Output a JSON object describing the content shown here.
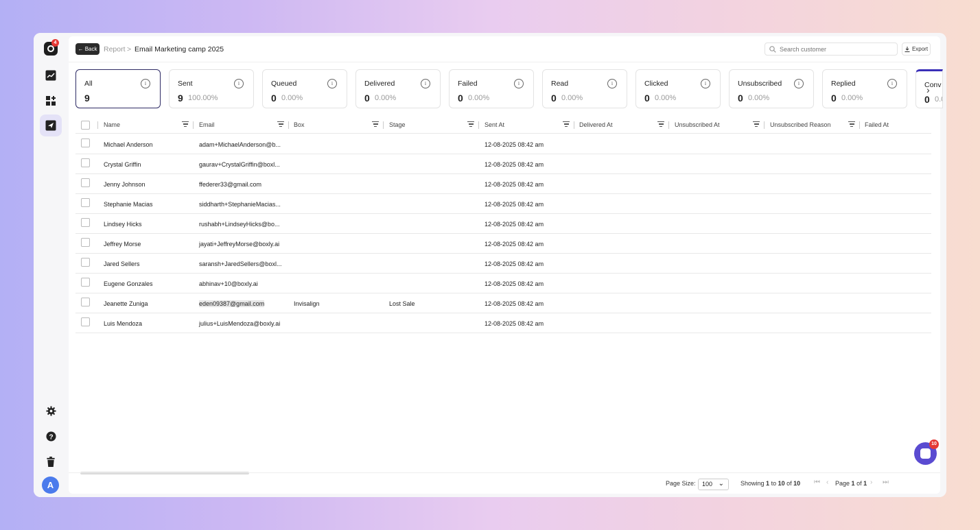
{
  "app": {
    "logo_badge": "4",
    "avatar_initial": "A",
    "chat_badge": "10"
  },
  "sidebar": {
    "items": [
      {
        "icon": "analytics-icon"
      },
      {
        "icon": "widgets-icon"
      },
      {
        "icon": "send-icon",
        "active": true
      }
    ],
    "bottom": [
      {
        "icon": "gear-icon"
      },
      {
        "icon": "help-icon"
      },
      {
        "icon": "trash-icon"
      }
    ]
  },
  "header": {
    "back_label": "← Back",
    "breadcrumb": {
      "parent": "Report",
      "separator": ">",
      "current": "Email Marketing camp 2025"
    },
    "search_placeholder": "Search customer",
    "export_label": "Export"
  },
  "cards": [
    {
      "label": "All",
      "count": "9",
      "pct": "",
      "active": true
    },
    {
      "label": "Sent",
      "count": "9",
      "pct": "100.00%"
    },
    {
      "label": "Queued",
      "count": "0",
      "pct": "0.00%"
    },
    {
      "label": "Delivered",
      "count": "0",
      "pct": "0.00%"
    },
    {
      "label": "Failed",
      "count": "0",
      "pct": "0.00%"
    },
    {
      "label": "Read",
      "count": "0",
      "pct": "0.00%"
    },
    {
      "label": "Clicked",
      "count": "0",
      "pct": "0.00%"
    },
    {
      "label": "Unsubscribed",
      "count": "0",
      "pct": "0.00%"
    },
    {
      "label": "Replied",
      "count": "0",
      "pct": "0.00%"
    },
    {
      "label": "Conv",
      "count": "0",
      "pct": "0.0"
    }
  ],
  "table": {
    "columns": [
      "Name",
      "Email",
      "Box",
      "Stage",
      "Sent At",
      "Delivered At",
      "Unsubscribed At",
      "Unsubscribed Reason",
      "Failed At"
    ],
    "rows": [
      {
        "name": "Michael Anderson",
        "email": "adam+MichaelAnderson@b...",
        "box": "",
        "stage": "",
        "sent_at": "12-08-2025 08:42 am"
      },
      {
        "name": "Crystal Griffin",
        "email": "gaurav+CrystalGriffin@boxl...",
        "box": "",
        "stage": "",
        "sent_at": "12-08-2025 08:42 am"
      },
      {
        "name": "Jenny Johnson",
        "email": "ffederer33@gmail.com",
        "box": "",
        "stage": "",
        "sent_at": "12-08-2025 08:42 am"
      },
      {
        "name": "Stephanie Macias",
        "email": "siddharth+StephanieMacias...",
        "box": "",
        "stage": "",
        "sent_at": "12-08-2025 08:42 am"
      },
      {
        "name": "Lindsey Hicks",
        "email": "rushabh+LindseyHicks@bo...",
        "box": "",
        "stage": "",
        "sent_at": "12-08-2025 08:42 am"
      },
      {
        "name": "Jeffrey Morse",
        "email": "jayati+JeffreyMorse@boxly.ai",
        "box": "",
        "stage": "",
        "sent_at": "12-08-2025 08:42 am"
      },
      {
        "name": "Jared Sellers",
        "email": "saransh+JaredSellers@boxl...",
        "box": "",
        "stage": "",
        "sent_at": "12-08-2025 08:42 am"
      },
      {
        "name": "Eugene Gonzales",
        "email": "abhinav+10@boxly.ai",
        "box": "",
        "stage": "",
        "sent_at": "12-08-2025 08:42 am"
      },
      {
        "name": "Jeanette Zuniga",
        "email": "eden09387@gmail.com",
        "box": "Invisalign",
        "stage": "Lost Sale",
        "sent_at": "12-08-2025 08:42 am",
        "email_highlight": true
      },
      {
        "name": "Luis Mendoza",
        "email": "julius+LuisMendoza@boxly.ai",
        "box": "",
        "stage": "",
        "sent_at": "12-08-2025 08:42 am"
      }
    ]
  },
  "footer": {
    "page_size_label": "Page Size:",
    "page_size_value": "100",
    "showing": {
      "prefix": "Showing",
      "from": "1",
      "to_word": "to",
      "to": "10",
      "of_word": "of",
      "total": "10"
    },
    "page": {
      "prefix": "Page",
      "current": "1",
      "of_word": "of",
      "total": "1"
    }
  }
}
